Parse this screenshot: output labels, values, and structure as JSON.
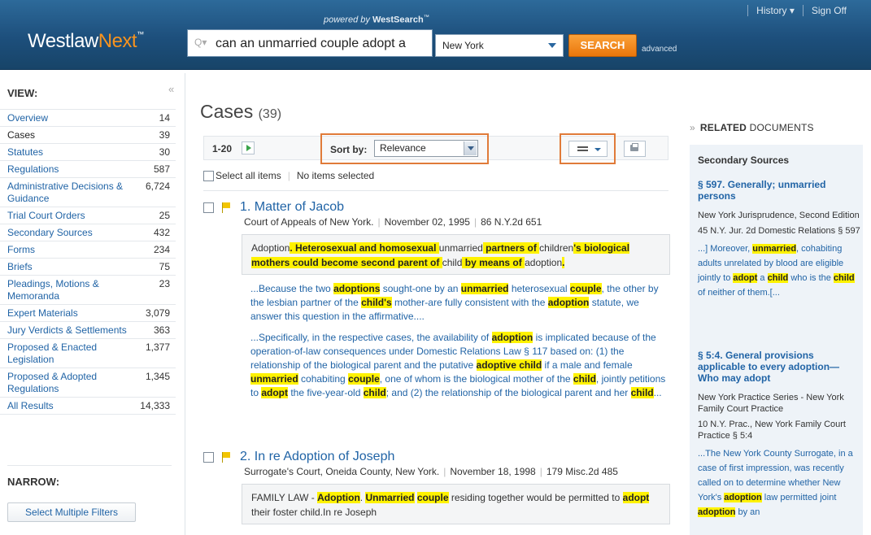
{
  "header": {
    "powered_by": "powered by",
    "powered_brand": "WestSearch",
    "logo_west": "Westlaw",
    "logo_next": "Next",
    "search_placeholder_icon": "Q▾",
    "search_value": "can an unmarried couple adopt a",
    "jurisdiction": "New York",
    "search_button": "SEARCH",
    "advanced": "advanced",
    "history": "History ▾",
    "sign_off": "Sign Off"
  },
  "sidebar": {
    "view_heading": "VIEW:",
    "collapse": "«",
    "items": [
      {
        "label": "Overview",
        "count": "14"
      },
      {
        "label": "Cases",
        "count": "39"
      },
      {
        "label": "Statutes",
        "count": "30"
      },
      {
        "label": "Regulations",
        "count": "587"
      },
      {
        "label": "Administrative Decisions & Guidance",
        "count": "6,724"
      },
      {
        "label": "Trial Court Orders",
        "count": "25"
      },
      {
        "label": "Secondary Sources",
        "count": "432"
      },
      {
        "label": "Forms",
        "count": "234"
      },
      {
        "label": "Briefs",
        "count": "75"
      },
      {
        "label": "Pleadings, Motions & Memoranda",
        "count": "23"
      },
      {
        "label": "Expert Materials",
        "count": "3,079"
      },
      {
        "label": "Jury Verdicts & Settlements",
        "count": "363"
      },
      {
        "label": "Proposed & Enacted Legislation",
        "count": "1,377"
      },
      {
        "label": "Proposed & Adopted Regulations",
        "count": "1,345"
      },
      {
        "label": "All Results",
        "count": "14,333"
      }
    ],
    "narrow_heading": "NARROW:",
    "multi_filter_button": "Select Multiple Filters"
  },
  "main": {
    "title": "Cases",
    "title_count": "(39)",
    "range": "1-20",
    "sort_label": "Sort by:",
    "sort_value": "Relevance",
    "select_all": "Select all items",
    "no_items": "No items selected",
    "results": [
      {
        "title": "1. Matter of Jacob",
        "court": "Court of Appeals of New York.",
        "date": "November 02, 1995",
        "cite": "86 N.Y.2d 651"
      },
      {
        "title": "2. In re Adoption of Joseph",
        "court": "Surrogate's Court, Oneida County, New York.",
        "date": "November 18, 1998",
        "cite": "179 Misc.2d 485"
      }
    ]
  },
  "rail": {
    "chevron": "»",
    "heading_bold": "RELATED",
    "heading_rest": "DOCUMENTS",
    "section": "Secondary Sources",
    "items": [
      {
        "title": "§ 597. Generally; unmarried persons",
        "source": "New York Jurisprudence, Second Edition",
        "cite": "45 N.Y. Jur. 2d Domestic Relations § 597"
      },
      {
        "title": "§ 5:4. General provisions applicable to every adoption—Who may adopt",
        "source": "New York Practice Series - New York Family Court Practice",
        "cite": "10 N.Y. Prac., New York Family Court Practice § 5:4"
      }
    ]
  },
  "text_runs": {
    "r1_summary": [
      "Adoption",
      ". Heterosexual and homosexual ",
      "unmarried",
      " partners of ",
      "children",
      "'s biological mothers could become second parent of ",
      "child",
      " by means of ",
      "adoption",
      "."
    ],
    "r1_snip1": [
      "...Because the two ",
      "adoptions",
      " sought-one by an ",
      "unmarried",
      " heterosexual ",
      "couple",
      ", the other by the lesbian partner of the ",
      "child's",
      " mother-are fully consistent with the ",
      "adoption",
      " statute, we answer this question in the affirmative...."
    ],
    "r1_snip2": [
      "...Specifically, in the respective cases, the availability of ",
      "adoption",
      " is implicated because of the operation-of-law consequences under Domestic Relations Law §  117 based on: (1) the relationship of the biological parent and the putative ",
      "adoptive child",
      " if a male and female ",
      "unmarried",
      " cohabiting ",
      "couple",
      ", one of whom is the biological mother of the ",
      "child",
      ", jointly petitions to ",
      "adopt",
      " the five-year-old ",
      "child",
      ";  and (2) the relationship of the biological parent and her ",
      "child",
      "..."
    ],
    "r2_summary": [
      "FAMILY LAW - ",
      "Adoption",
      ". ",
      "Unmarried",
      " ",
      "couple",
      " residing together would be permitted to ",
      "adopt",
      " their foster child.In re Joseph"
    ],
    "rail1_ex": [
      "...] Moreover, ",
      "unmarried",
      ", cohabiting adults unrelated by blood are eligible jointly to ",
      "adopt",
      " a ",
      "child",
      " who is the ",
      "child",
      " of neither of them.[..."
    ],
    "rail2_ex": [
      "...The New York County Surrogate, in a case of first impression, was recently called on to determine whether New York's ",
      "adoption",
      " law permitted joint ",
      "adoption",
      " by an"
    ]
  },
  "colors": {
    "header_bg": "#1d4f7c",
    "link": "#2164a6",
    "highlight": "#fff200",
    "accent_orange": "#f7931e",
    "callout_border": "#e07b39"
  }
}
